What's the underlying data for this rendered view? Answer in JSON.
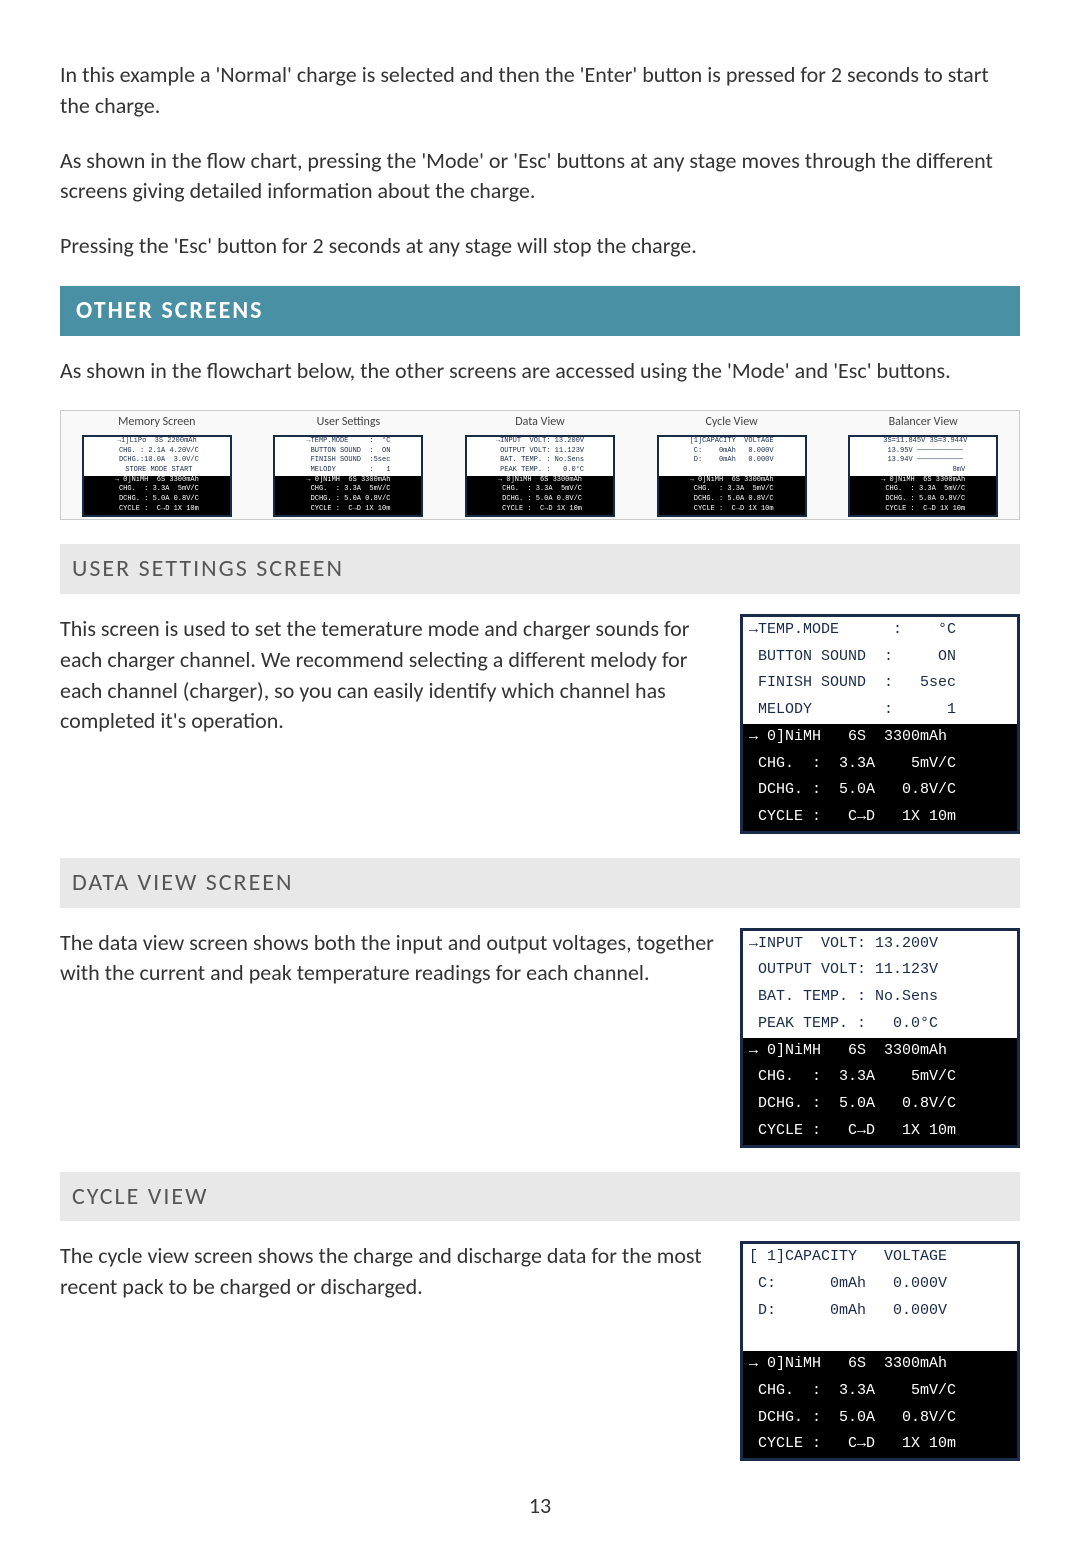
{
  "intro": {
    "p1": "In this example a 'Normal' charge is selected and then the 'Enter' button is pressed for 2 seconds to start the charge.",
    "p2": "As shown in the flow chart, pressing the 'Mode' or 'Esc' buttons at any stage moves through the different screens giving detailed information about the charge.",
    "p3": "Pressing the 'Esc' button for 2 seconds at any stage will stop the charge."
  },
  "other_screens": {
    "heading": "OTHER SCREENS",
    "p": "As shown in the flowchart below, the other screens are accessed using the 'Mode' and 'Esc' buttons."
  },
  "flow": {
    "labels": [
      "Memory Screen",
      "User Settings",
      "Data View",
      "Cycle View",
      "Balancer View"
    ],
    "mem": {
      "w1": "→1]LiPo  3S 2200mAh",
      "w2": " CHG. : 2.1A 4.20V/C",
      "w3": " DCHG.:10.0A  3.0V/C",
      "w4": " STORE MODE START",
      "b1": "→ 0]NiMH  6S 3300mAh",
      "b2": " CHG.  : 3.3A  5mV/C",
      "b3": " DCHG. : 5.0A 0.8V/C",
      "b4": " CYCLE :  C→D 1X 10m"
    },
    "user": {
      "w1": "→TEMP.MODE     :  °C",
      "w2": " BUTTON SOUND  :  ON",
      "w3": " FINISH SOUND  :5sec",
      "w4": " MELODY        :   1",
      "b1": "→ 0]NiMH  6S 3300mAh",
      "b2": " CHG.  : 3.3A  5mV/C",
      "b3": " DCHG. : 5.0A 0.8V/C",
      "b4": " CYCLE :  C→D 1X 10m"
    },
    "data": {
      "w1": "→INPUT  VOLT: 13.200V",
      "w2": " OUTPUT VOLT: 11.123V",
      "w3": " BAT. TEMP. : No.Sens",
      "w4": " PEAK TEMP. :   0.0°C",
      "b1": "→ 0]NiMH  6S 3300mAh",
      "b2": " CHG.  : 3.3A  5mV/C",
      "b3": " DCHG. : 5.0A 0.8V/C",
      "b4": " CYCLE :  C→D 1X 10m"
    },
    "cycle": {
      "w1": "[1]CAPACITY  VOLTAGE",
      "w2": " C:    0mAh   0.000V",
      "w3": " D:    0mAh   0.000V",
      "w4": "                    ",
      "b1": "→ 0]NiMH  6S 3300mAh",
      "b2": " CHG.  : 3.3A  5mV/C",
      "b3": " DCHG. : 5.0A 0.8V/C",
      "b4": " CYCLE :  C→D 1X 10m"
    },
    "bal": {
      "w1": " 3S=11.845V 3S=3.944V",
      "w2": " 13.95V ───────────",
      "w3": " 13.94V ───────────",
      "w4": "                 8mV",
      "b1": "→ 0]NiMH  6S 3300mAh",
      "b2": " CHG.  : 3.3A  5mV/C",
      "b3": " DCHG. : 5.0A 0.8V/C",
      "b4": " CYCLE :  C→D 1X 10m"
    }
  },
  "user_settings": {
    "heading": "USER SETTINGS SCREEN",
    "p": "This screen is used to set the temerature mode and charger sounds for each charger channel. We recommend selecting a different melody for each channel (charger), so you can easily identify which channel has completed it's operation.",
    "lcd": {
      "w1": "→TEMP.MODE      :    °C",
      "w2": " BUTTON SOUND  :     ON",
      "w3": " FINISH SOUND  :   5sec",
      "w4": " MELODY        :      1",
      "b1": "→ 0]NiMH   6S  3300mAh",
      "b2": " CHG.  :  3.3A    5mV/C",
      "b3": " DCHG. :  5.0A   0.8V/C",
      "b4": " CYCLE :   C→D   1X 10m"
    }
  },
  "data_view": {
    "heading": "DATA VIEW SCREEN",
    "p": "The data view screen shows both the input and output voltages, together with the current and peak temperature readings for each channel.",
    "lcd": {
      "w1": "→INPUT  VOLT: 13.200V",
      "w2": " OUTPUT VOLT: 11.123V",
      "w3": " BAT. TEMP. : No.Sens",
      "w4": " PEAK TEMP. :   0.0°C",
      "b1": "→ 0]NiMH   6S  3300mAh",
      "b2": " CHG.  :  3.3A    5mV/C",
      "b3": " DCHG. :  5.0A   0.8V/C",
      "b4": " CYCLE :   C→D   1X 10m"
    }
  },
  "cycle_view": {
    "heading": "CYCLE VIEW",
    "p": "The cycle view screen shows the charge and discharge data for the most recent pack to be charged or discharged.",
    "lcd": {
      "w1": "[ 1]CAPACITY   VOLTAGE",
      "w2": " C:      0mAh   0.000V",
      "w3": " D:      0mAh   0.000V",
      "w4": "                       ",
      "b1": "→ 0]NiMH   6S  3300mAh",
      "b2": " CHG.  :  3.3A    5mV/C",
      "b3": " DCHG. :  5.0A   0.8V/C",
      "b4": " CYCLE :   C→D   1X 10m"
    }
  },
  "page_number": "13"
}
